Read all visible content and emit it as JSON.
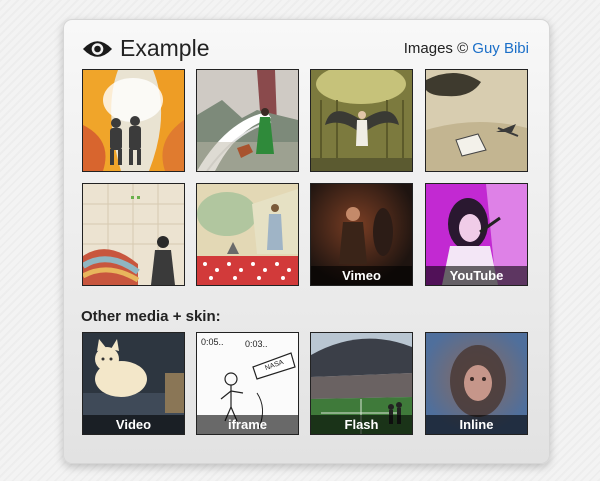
{
  "gallery": {
    "title": "Example",
    "title_icon": "eye-icon",
    "credit_prefix": "Images © ",
    "credit_link": "Guy Bibi",
    "link_color": "#1b6fc8"
  },
  "other_section": {
    "label": "Other media + skin:"
  },
  "rows": [
    [
      {
        "name": "astronauts"
      },
      {
        "name": "lady-in-green"
      },
      {
        "name": "winged-figure"
      },
      {
        "name": "floating-tree"
      }
    ],
    [
      {
        "name": "bowler-hat-man"
      },
      {
        "name": "soldier-in-field"
      },
      {
        "name": "vimeo",
        "caption": "Vimeo"
      },
      {
        "name": "youtube",
        "caption": "YouTube"
      }
    ],
    [
      {
        "name": "video",
        "caption": "Video"
      },
      {
        "name": "iframe",
        "caption": "iframe",
        "sketch_labels": [
          "0:05..",
          "0:03..",
          "NASA"
        ]
      },
      {
        "name": "flash",
        "caption": "Flash"
      },
      {
        "name": "inline",
        "caption": "Inline"
      }
    ]
  ]
}
